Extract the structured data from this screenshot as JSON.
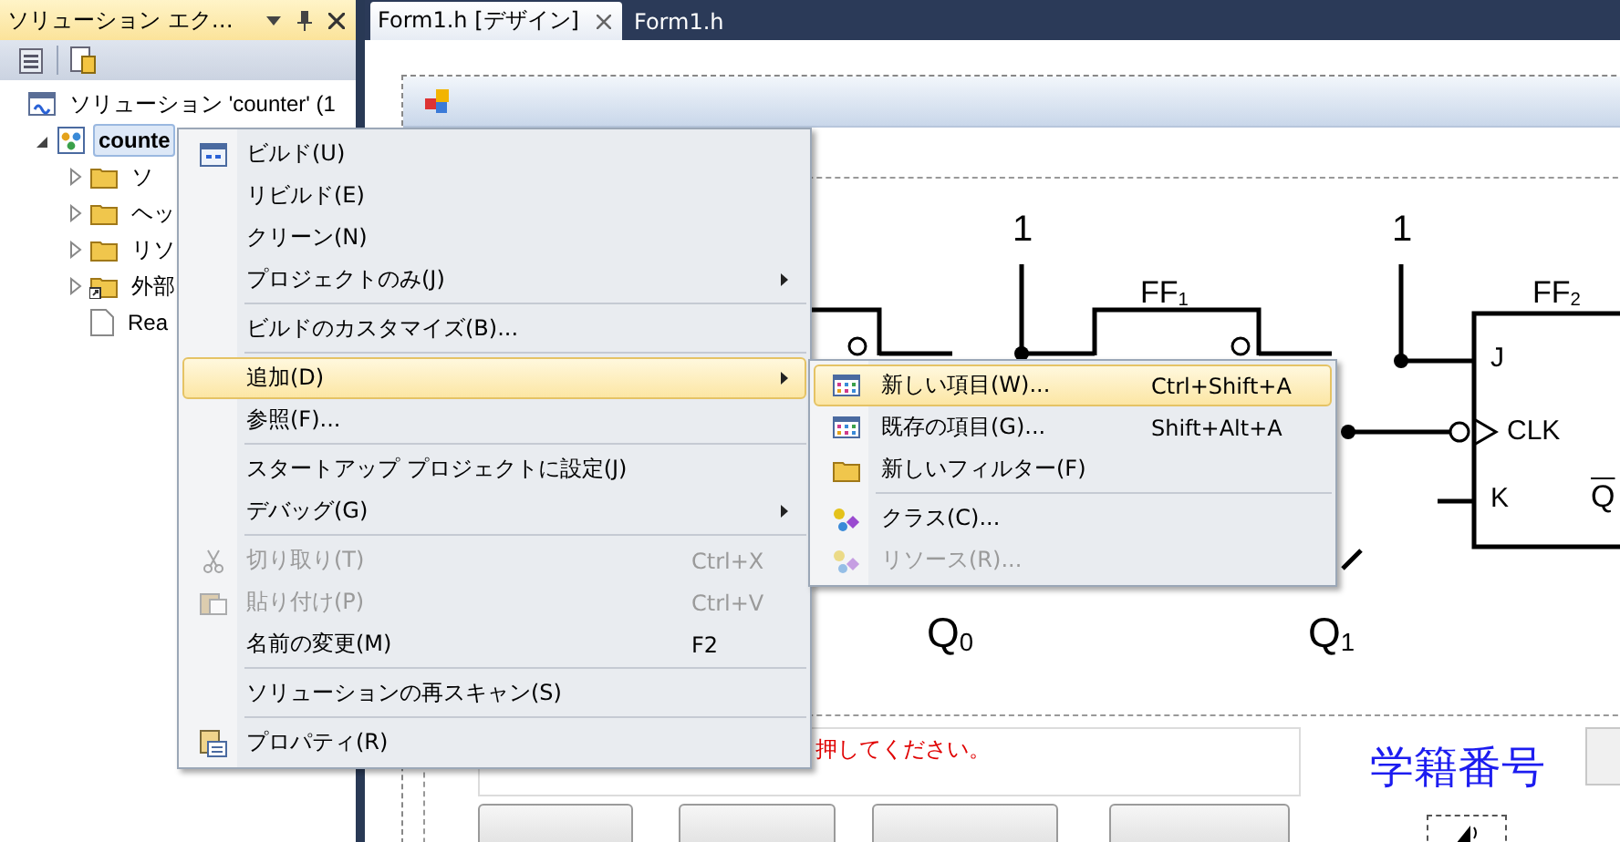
{
  "explorer": {
    "title": "ソリューション エク…",
    "tree": [
      {
        "label": "ソリューション 'counter' (1",
        "kind": "solution",
        "selected": false,
        "children": [
          {
            "label": "counte",
            "kind": "project",
            "selected": true,
            "expanded": true,
            "children": [
              {
                "label": "ソ",
                "kind": "folder",
                "selected": false,
                "expanded": false
              },
              {
                "label": "ヘッ",
                "kind": "folder",
                "selected": false,
                "expanded": false
              },
              {
                "label": "リソ",
                "kind": "folder",
                "selected": false,
                "expanded": false
              },
              {
                "label": "外部",
                "kind": "external",
                "selected": false,
                "expanded": false
              },
              {
                "label": "Rea",
                "kind": "file",
                "selected": false
              }
            ]
          }
        ]
      }
    ]
  },
  "tabs": [
    {
      "label": "Form1.h [デザイン]",
      "selected": true,
      "closable": true
    },
    {
      "label": "Form1.h",
      "selected": false,
      "closable": false
    }
  ],
  "designer": {
    "circuit": {
      "input_1": "1",
      "input_2": "1",
      "ff1_label": "FF$_{1}$",
      "ff2_label": "FF$_{2}$",
      "j": "J",
      "clk": "CLK",
      "k": "K",
      "q_bar": "Q",
      "q0": "Q$_{0}$",
      "q1": "Q$_{1}$"
    },
    "message": "押してください。",
    "student_id_label": "学籍番号"
  },
  "context_menu": {
    "items": [
      {
        "kind": "item",
        "label": "ビルド(U)",
        "disabled": false,
        "selected": false,
        "submenu": false
      },
      {
        "kind": "item",
        "label": "リビルド(E)",
        "disabled": false,
        "selected": false,
        "submenu": false
      },
      {
        "kind": "item",
        "label": "クリーン(N)",
        "disabled": false,
        "selected": false,
        "submenu": false
      },
      {
        "kind": "item",
        "label": "プロジェクトのみ(J)",
        "disabled": false,
        "selected": false,
        "submenu": true
      },
      {
        "kind": "separator"
      },
      {
        "kind": "item",
        "label": "ビルドのカスタマイズ(B)...",
        "disabled": false,
        "selected": false,
        "submenu": false
      },
      {
        "kind": "separator"
      },
      {
        "kind": "item",
        "label": "追加(D)",
        "disabled": false,
        "selected": true,
        "submenu": true
      },
      {
        "kind": "item",
        "label": "参照(F)...",
        "disabled": false,
        "selected": false,
        "submenu": false
      },
      {
        "kind": "separator"
      },
      {
        "kind": "item",
        "label": "スタートアップ プロジェクトに設定(J)",
        "disabled": false,
        "selected": false,
        "submenu": false
      },
      {
        "kind": "item",
        "label": "デバッグ(G)",
        "disabled": false,
        "selected": false,
        "submenu": true
      },
      {
        "kind": "separator"
      },
      {
        "kind": "item",
        "label": "切り取り(T)",
        "shortcut": "Ctrl+X",
        "disabled": true,
        "selected": false,
        "submenu": false
      },
      {
        "kind": "item",
        "label": "貼り付け(P)",
        "shortcut": "Ctrl+V",
        "disabled": true,
        "selected": false,
        "submenu": false
      },
      {
        "kind": "item",
        "label": "名前の変更(M)",
        "shortcut": "F2",
        "disabled": false,
        "selected": false,
        "submenu": false
      },
      {
        "kind": "separator"
      },
      {
        "kind": "item",
        "label": "ソリューションの再スキャン(S)",
        "disabled": false,
        "selected": false,
        "submenu": false
      },
      {
        "kind": "separator"
      },
      {
        "kind": "item",
        "label": "プロパティ(R)",
        "disabled": false,
        "selected": false,
        "submenu": false
      }
    ]
  },
  "submenu": {
    "items": [
      {
        "kind": "item",
        "label": "新しい項目(W)...",
        "shortcut": "Ctrl+Shift+A",
        "disabled": false,
        "selected": true
      },
      {
        "kind": "item",
        "label": "既存の項目(G)...",
        "shortcut": "Shift+Alt+A",
        "disabled": false,
        "selected": false
      },
      {
        "kind": "item",
        "label": "新しいフィルター(F)",
        "disabled": false,
        "selected": false
      },
      {
        "kind": "separator"
      },
      {
        "kind": "item",
        "label": "クラス(C)...",
        "disabled": false,
        "selected": false
      },
      {
        "kind": "item",
        "label": "リソース(R)...",
        "disabled": true,
        "selected": false
      }
    ]
  }
}
